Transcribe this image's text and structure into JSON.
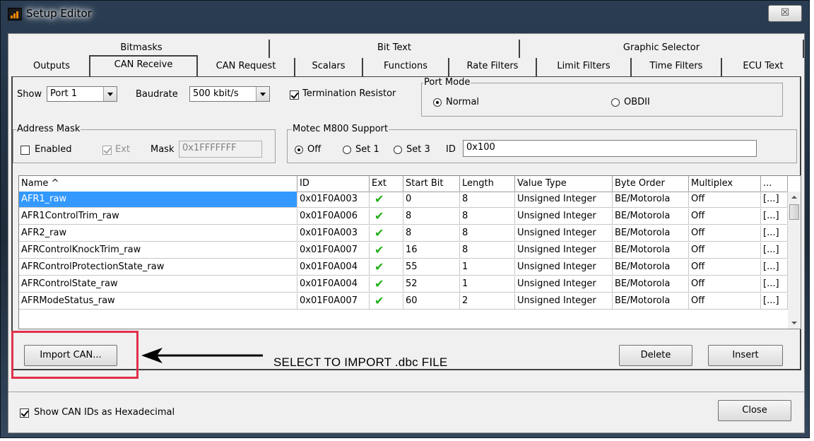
{
  "window": {
    "title": "Setup Editor",
    "close_glyph": "☒"
  },
  "tabs": {
    "row1": [
      "Bitmasks",
      "Bit Text",
      "Graphic Selector"
    ],
    "row2": [
      "Outputs",
      "CAN Receive",
      "CAN Request",
      "Scalars",
      "Functions",
      "Rate Filters",
      "Limit Filters",
      "Time Filters",
      "ECU Text"
    ],
    "active": "CAN Receive"
  },
  "controls": {
    "show_label": "Show",
    "show_value": "Port 1",
    "baud_label": "Baudrate",
    "baud_value": "500 kbit/s",
    "termination_label": "Termination Resistor",
    "termination_checked": true,
    "port_mode": {
      "title": "Port Mode",
      "normal": "Normal",
      "obdii": "OBDII",
      "selected": "Normal"
    },
    "address_mask": {
      "title": "Address Mask",
      "enabled_label": "Enabled",
      "ext_label": "Ext",
      "mask_label": "Mask",
      "mask_value": "0x1FFFFFFF"
    },
    "motec": {
      "title": "Motec M800 Support",
      "off": "Off",
      "set1": "Set 1",
      "set3": "Set 3",
      "selected": "Off",
      "id_label": "ID",
      "id_value": "0x100"
    }
  },
  "grid": {
    "headers": [
      "Name ^",
      "ID",
      "Ext",
      "Start Bit",
      "Length",
      "Value Type",
      "Byte Order",
      "Multiplex",
      "..."
    ],
    "rows": [
      [
        "AFR1_raw",
        "0x01F0A003",
        "✔",
        "0",
        "8",
        "Unsigned Integer",
        "BE/Motorola",
        "Off",
        "[...]"
      ],
      [
        "AFR1ControlTrim_raw",
        "0x01F0A006",
        "✔",
        "8",
        "8",
        "Unsigned Integer",
        "BE/Motorola",
        "Off",
        "[...]"
      ],
      [
        "AFR2_raw",
        "0x01F0A003",
        "✔",
        "8",
        "8",
        "Unsigned Integer",
        "BE/Motorola",
        "Off",
        "[...]"
      ],
      [
        "AFRControlKnockTrim_raw",
        "0x01F0A007",
        "✔",
        "16",
        "8",
        "Unsigned Integer",
        "BE/Motorola",
        "Off",
        "[...]"
      ],
      [
        "AFRControlProtectionState_raw",
        "0x01F0A004",
        "✔",
        "55",
        "1",
        "Unsigned Integer",
        "BE/Motorola",
        "Off",
        "[...]"
      ],
      [
        "AFRControlState_raw",
        "0x01F0A004",
        "✔",
        "52",
        "1",
        "Unsigned Integer",
        "BE/Motorola",
        "Off",
        "[...]"
      ],
      [
        "AFRModeStatus_raw",
        "0x01F0A007",
        "✔",
        "60",
        "2",
        "Unsigned Integer",
        "BE/Motorola",
        "Off",
        "[...]"
      ]
    ]
  },
  "buttons": {
    "import": "Import CAN...",
    "delete": "Delete",
    "insert": "Insert",
    "close": "Close"
  },
  "annotation": {
    "text": "SELECT TO IMPORT .dbc FILE",
    "color": "#e0304c"
  },
  "footer": {
    "hex_label": "Show CAN IDs as Hexadecimal",
    "hex_checked": true
  }
}
